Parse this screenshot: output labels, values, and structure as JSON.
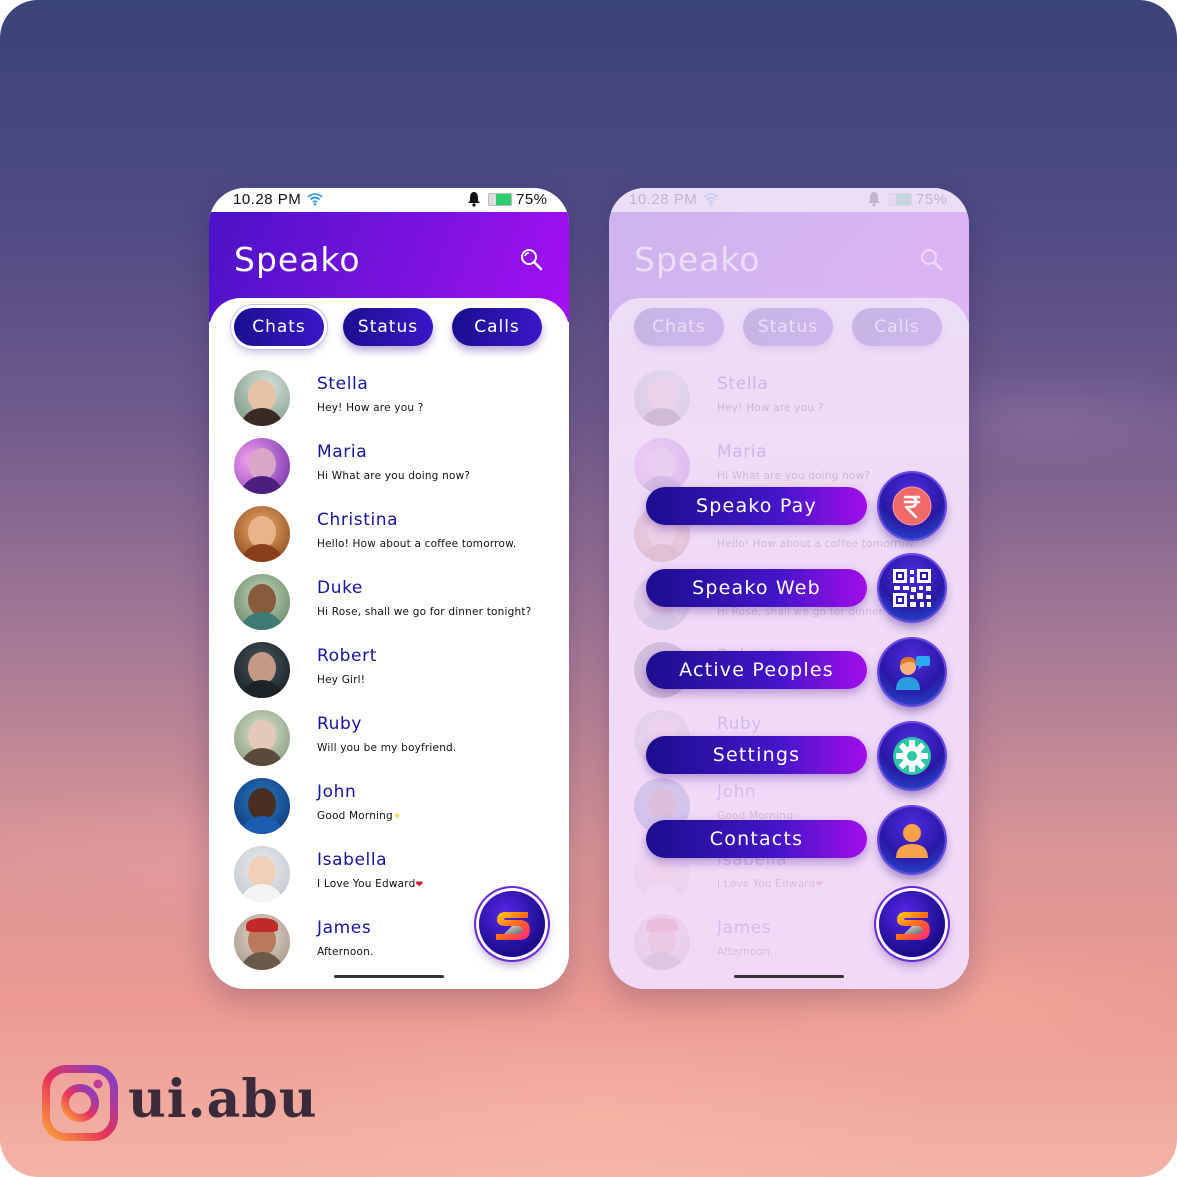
{
  "status_bar": {
    "time": "10.28 PM",
    "battery": "75%"
  },
  "app": {
    "title": "Speako"
  },
  "tabs": [
    {
      "label": "Chats"
    },
    {
      "label": "Status"
    },
    {
      "label": "Calls"
    }
  ],
  "chats": [
    {
      "name": "Stella",
      "message": "Hey! How are you ?",
      "emoji": ""
    },
    {
      "name": "Maria",
      "message": "Hi What are you doing now?",
      "emoji": ""
    },
    {
      "name": "Christina",
      "message": "Hello! How about a coffee tomorrow.",
      "emoji": ""
    },
    {
      "name": "Duke",
      "message": "Hi Rose, shall we go for dinner tonight?",
      "emoji": ""
    },
    {
      "name": "Robert",
      "message": "Hey Girl!",
      "emoji": ""
    },
    {
      "name": "Ruby",
      "message": "Will you be my boyfriend.",
      "emoji": ""
    },
    {
      "name": "John",
      "message": "Good Morning",
      "emoji": "☀"
    },
    {
      "name": "Isabella",
      "message": "I Love You Edward",
      "emoji": "❤"
    },
    {
      "name": "James",
      "message": "Afternoon.",
      "emoji": ""
    }
  ],
  "fab_menu": [
    {
      "label": "Speako Pay",
      "icon": "rupee-icon"
    },
    {
      "label": "Speako Web",
      "icon": "qr-code-icon"
    },
    {
      "label": "Active Peoples",
      "icon": "active-people-icon"
    },
    {
      "label": "Settings",
      "icon": "gear-icon"
    },
    {
      "label": "Contacts",
      "icon": "contact-person-icon"
    }
  ],
  "watermark": {
    "handle": "ui.abu",
    "icon": "instagram-icon"
  },
  "colors": {
    "header_gradient_start": "#4b12c6",
    "header_gradient_end": "#a510f2",
    "name_color": "#18139a",
    "tab_color": "#1a0f8f"
  }
}
